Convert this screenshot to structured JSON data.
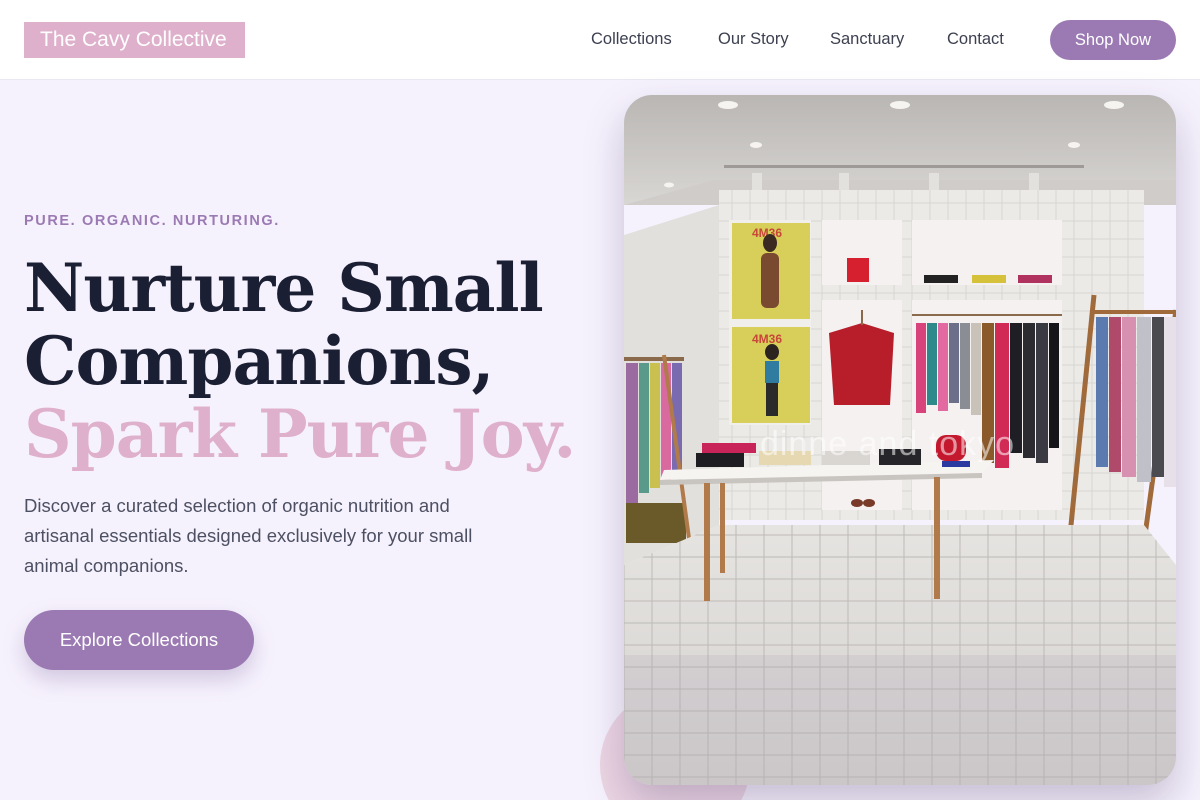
{
  "brand": {
    "name": "The Cavy Collective"
  },
  "nav": {
    "links": [
      "Collections",
      "Our Story",
      "Sanctuary",
      "Contact"
    ],
    "cta": "Shop Now"
  },
  "hero": {
    "eyebrow": "PURE. ORGANIC. NURTURING.",
    "headline_line1": "Nurture Small",
    "headline_line2": "Companions,",
    "headline_accent": "Spark Pure Joy.",
    "description": "Discover a curated selection of organic nutrition and artisanal essentials designed exclusively for your small animal companions.",
    "cta": "Explore Collections"
  },
  "hero_image": {
    "poster_text": "4M36",
    "watermark": "dinne and tokyo"
  },
  "colors": {
    "accent": "#9b7ab3",
    "pink": "#dfb0cb",
    "background": "#f6f2fd",
    "text": "#1b1f33"
  }
}
